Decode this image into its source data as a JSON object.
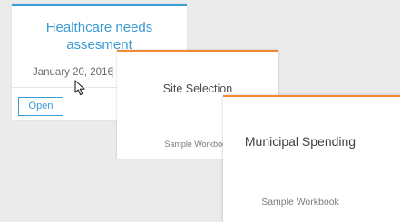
{
  "cards": [
    {
      "title": "Healthcare needs assesment",
      "date": "January 20, 2016",
      "open_label": "Open",
      "accent_color": "#3d9fd6"
    },
    {
      "title": "Site Selection",
      "subtitle": "Sample Workbook",
      "accent_color": "#f08a33"
    },
    {
      "title": "Municipal Spending",
      "subtitle": "Sample Workbook",
      "accent_color": "#f08a33"
    }
  ],
  "cursor_icon": "arrow-cursor-icon"
}
